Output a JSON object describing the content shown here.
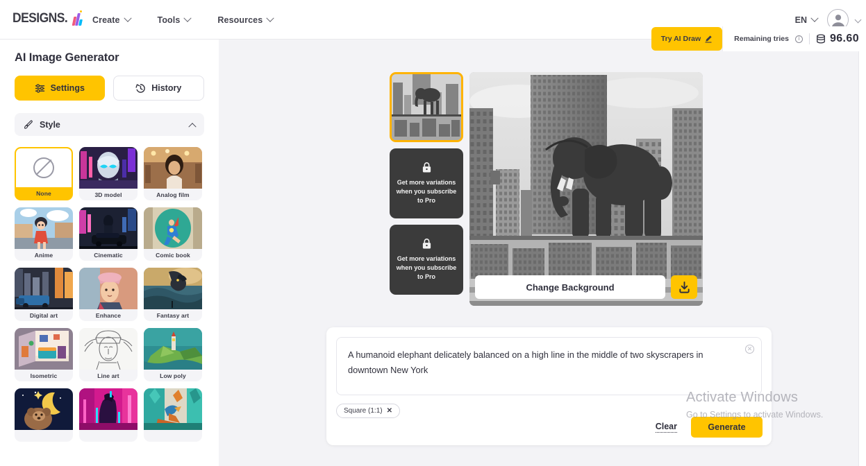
{
  "header": {
    "logo_text": "DESIGNS.",
    "logo_mark": "ai-logo-icon",
    "nav": [
      {
        "label": "Create"
      },
      {
        "label": "Tools"
      },
      {
        "label": "Resources"
      }
    ],
    "language": "EN",
    "avatar": "user-avatar-icon"
  },
  "subbar": {
    "try_ai_draw": "Try AI Draw",
    "remaining_tries_label": "Remaining tries",
    "info_icon": "info-icon",
    "credits": "96.60",
    "coin_icon": "coin-icon"
  },
  "sidebar": {
    "title": "AI Image Generator",
    "tabs": [
      {
        "label": "Settings",
        "icon": "sliders-icon",
        "active": true
      },
      {
        "label": "History",
        "icon": "history-clock-icon",
        "active": false
      }
    ],
    "accordion": {
      "label": "Style",
      "icon": "brush-icon",
      "chevron": "chevron-up-icon",
      "expanded": true
    },
    "styles": [
      {
        "label": "None",
        "selected": true,
        "thumb": "none-circle-slash-icon"
      },
      {
        "label": "3D model",
        "selected": false
      },
      {
        "label": "Analog film",
        "selected": false
      },
      {
        "label": "Anime",
        "selected": false
      },
      {
        "label": "Cinematic",
        "selected": false
      },
      {
        "label": "Comic book",
        "selected": false
      },
      {
        "label": "Digital art",
        "selected": false
      },
      {
        "label": "Enhance",
        "selected": false
      },
      {
        "label": "Fantasy art",
        "selected": false
      },
      {
        "label": "Isometric",
        "selected": false
      },
      {
        "label": "Line art",
        "selected": false
      },
      {
        "label": "Low poly",
        "selected": false
      },
      {
        "label": "",
        "selected": false
      },
      {
        "label": "",
        "selected": false
      },
      {
        "label": "",
        "selected": false
      }
    ]
  },
  "canvas": {
    "variations": [
      {
        "type": "image",
        "selected": true,
        "alt": "elephant-on-highline-thumbnail"
      },
      {
        "type": "locked",
        "text": "Get more variations when you subscribe to Pro",
        "icon": "lock-icon"
      },
      {
        "type": "locked",
        "text": "Get more variations when you subscribe to Pro",
        "icon": "lock-icon"
      }
    ],
    "preview": {
      "alt": "generated-image-elephant-balancing-between-skyscrapers",
      "change_background_label": "Change Background",
      "download_icon": "download-icon"
    }
  },
  "prompt": {
    "value": "A humanoid elephant delicately balanced on a high line in the middle of two skyscrapers in downtown New York",
    "clear_icon": "clear-circle-icon",
    "chip": {
      "label": "Square (1:1)",
      "remove_icon": "close-x-icon"
    },
    "clear_label": "Clear",
    "generate_label": "Generate"
  },
  "watermark": {
    "line1": "Activate Windows",
    "line2": "Go to Settings to activate Windows."
  },
  "colors": {
    "accent": "#ffc400",
    "accent_border": "#ffb300",
    "text_dark": "#2f2f3c",
    "canvas_bg": "#f3f3f6",
    "locked_bg": "#3b3b3b"
  }
}
